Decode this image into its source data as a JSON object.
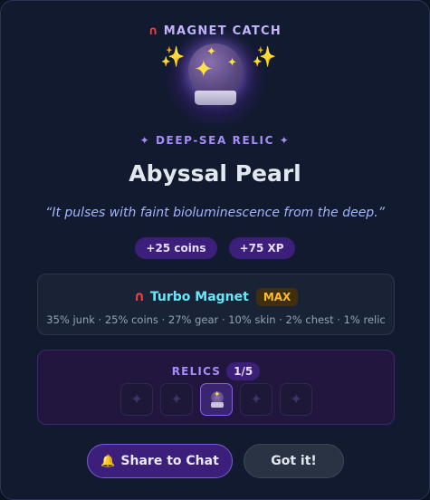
{
  "header": {
    "icon": "magnet-icon",
    "title": "MAGNET CATCH"
  },
  "item": {
    "image": "crystal-ball-icon",
    "category": "✦ DEEP-SEA RELIC ✦",
    "name": "Abyssal Pearl",
    "description": "“It pulses with faint bioluminescence from the deep.”"
  },
  "rewards": [
    "+25 coins",
    "+75 XP"
  ],
  "magnet": {
    "icon": "magnet-icon",
    "name": "Turbo Magnet",
    "badge": "MAX",
    "odds": "35% junk · 25% coins · 27% gear · 10% skin · 2% chest · 1% relic"
  },
  "relics": {
    "label": "RELICS",
    "count": "1/5",
    "collected": 1,
    "total": 5,
    "slots": [
      "empty",
      "empty",
      "crystal-ball",
      "empty",
      "empty"
    ]
  },
  "buttons": {
    "share_icon": "bell-icon",
    "share_label": "Share to Chat",
    "ok_label": "Got it!"
  },
  "colors": {
    "accent": "#8b5cf6",
    "name": "#67e8f9",
    "badge": "#fbbf24"
  }
}
